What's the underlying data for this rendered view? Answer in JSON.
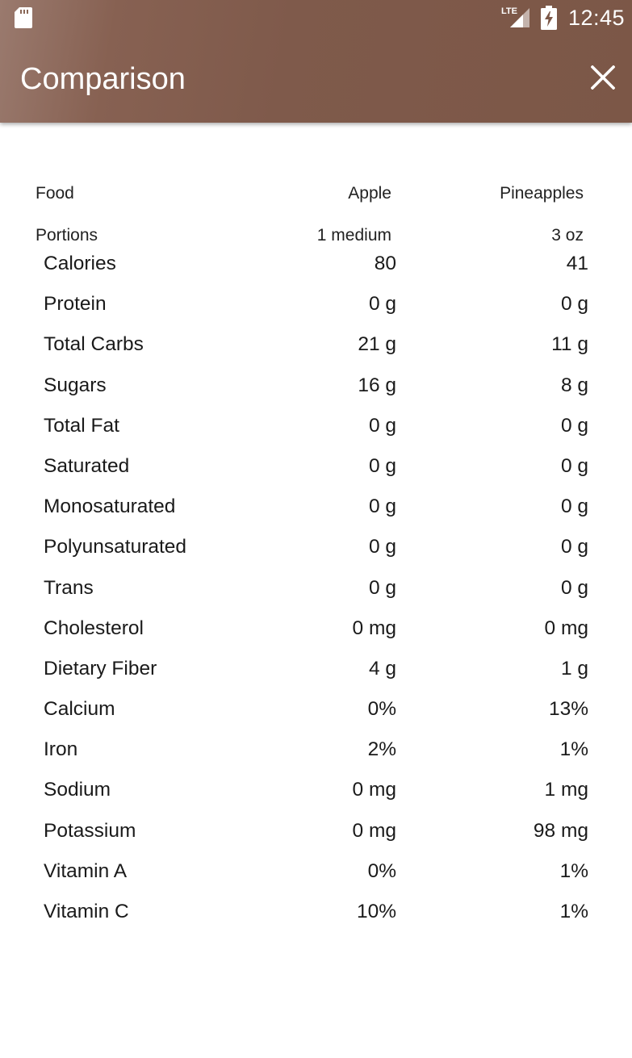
{
  "status_bar": {
    "time": "12:45",
    "network": "LTE"
  },
  "app_bar": {
    "title": "Comparison",
    "close_icon": "close-icon"
  },
  "header": {
    "food_label": "Food",
    "food_1": "Apple",
    "food_2": "Pineapples",
    "portions_label": "Portions",
    "portion_1": "1 medium",
    "portion_2": "3 oz"
  },
  "nutrients": [
    {
      "name": "Calories",
      "v1": "80",
      "v2": "41"
    },
    {
      "name": "Protein",
      "v1": "0 g",
      "v2": "0 g"
    },
    {
      "name": "Total Carbs",
      "v1": "21 g",
      "v2": "11 g"
    },
    {
      "name": "Sugars",
      "v1": "16 g",
      "v2": "8 g"
    },
    {
      "name": "Total Fat",
      "v1": "0 g",
      "v2": "0 g"
    },
    {
      "name": "Saturated",
      "v1": "0 g",
      "v2": "0 g"
    },
    {
      "name": "Monosaturated",
      "v1": "0 g",
      "v2": "0 g"
    },
    {
      "name": "Polyunsaturated",
      "v1": "0 g",
      "v2": "0 g"
    },
    {
      "name": "Trans",
      "v1": "0 g",
      "v2": "0 g"
    },
    {
      "name": "Cholesterol",
      "v1": "0 mg",
      "v2": "0 mg"
    },
    {
      "name": "Dietary Fiber",
      "v1": "4 g",
      "v2": "1 g"
    },
    {
      "name": "Calcium",
      "v1": "0%",
      "v2": "13%"
    },
    {
      "name": "Iron",
      "v1": "2%",
      "v2": "1%"
    },
    {
      "name": "Sodium",
      "v1": "0 mg",
      "v2": "1 mg"
    },
    {
      "name": "Potassium",
      "v1": "0 mg",
      "v2": "98 mg"
    },
    {
      "name": "Vitamin A",
      "v1": "0%",
      "v2": "1%"
    },
    {
      "name": "Vitamin C",
      "v1": "10%",
      "v2": "1%"
    }
  ],
  "colors": {
    "app_bar": "#7c5747",
    "app_bar_text": "#ffffff",
    "body_text": "#1a1a1a",
    "background": "#ffffff"
  }
}
